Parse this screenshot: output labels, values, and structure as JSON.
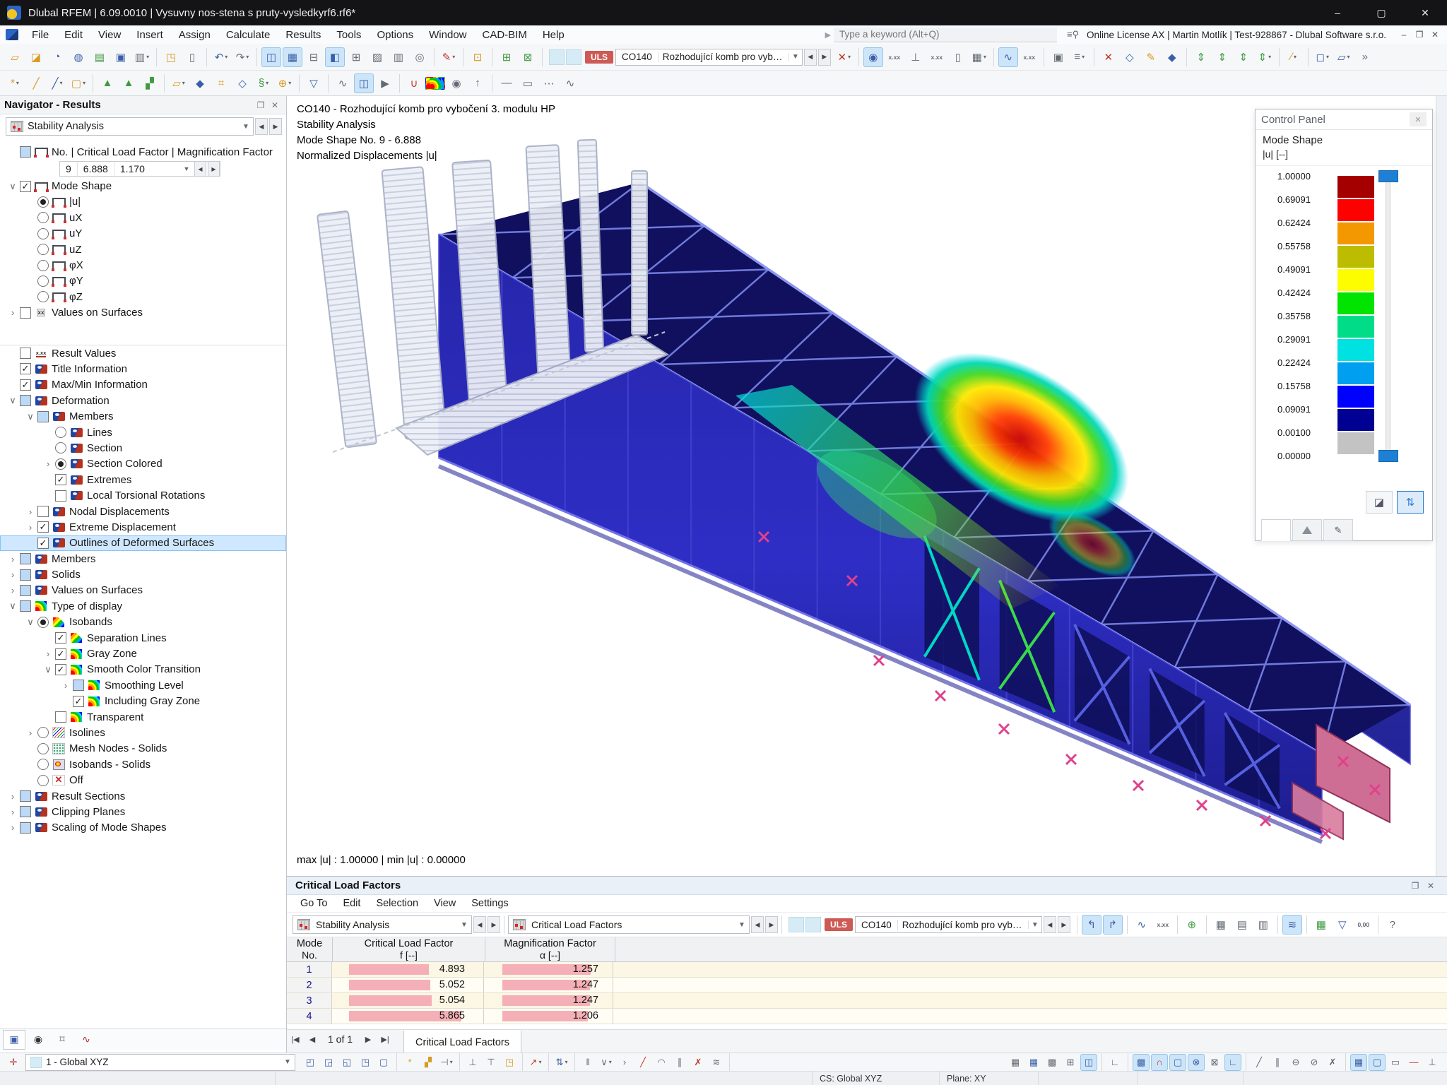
{
  "window": {
    "title": "Dlubal RFEM | 6.09.0010 | Vysuvny nos-stena s pruty-vysledkyrf6.rf6*",
    "minimize": "–",
    "maximize": "▢",
    "close": "✕"
  },
  "menu": {
    "items": [
      "File",
      "Edit",
      "View",
      "Insert",
      "Assign",
      "Calculate",
      "Results",
      "Tools",
      "Options",
      "Window",
      "CAD-BIM",
      "Help"
    ]
  },
  "topbar": {
    "search_placeholder": "Type a keyword (Alt+Q)",
    "license": "Online License AX | Martin Motlík | Test-928867 - Dlubal Software s.r.o."
  },
  "load_combo": {
    "uls": "ULS",
    "co": "CO140",
    "name": "Rozhodující komb pro vyboč..."
  },
  "toolbar1": [
    [
      "▱",
      "y",
      0,
      0,
      "new-model",
      0
    ],
    [
      "◪",
      "y",
      0,
      0,
      "open-model",
      0
    ],
    [
      "◔",
      "b",
      0,
      0,
      "refresh-data",
      0
    ],
    [
      "◍",
      "b",
      0,
      0,
      "rendering",
      0
    ],
    [
      "▤",
      "g",
      0,
      0,
      "printout-graphic",
      0
    ],
    [
      "▣",
      "b",
      0,
      0,
      "save",
      0
    ],
    [
      "▥",
      "k",
      0,
      1,
      "print",
      1
    ],
    [
      "◳",
      "y",
      0,
      0,
      "new-report",
      0
    ],
    [
      "▯",
      "k",
      0,
      1,
      "printout-report",
      0
    ],
    [
      "↶",
      "b",
      0,
      0,
      "undo",
      1
    ],
    [
      "↷",
      "k",
      0,
      1,
      "redo",
      1
    ],
    [
      "◫",
      "b",
      1,
      0,
      "navigator-toggle",
      0
    ],
    [
      "▦",
      "b",
      1,
      0,
      "tables-toggle",
      0
    ],
    [
      "⊟",
      "k",
      0,
      0,
      "split-view",
      0
    ],
    [
      "◧",
      "b",
      1,
      0,
      "panel-toggle",
      0
    ],
    [
      "⊞",
      "k",
      0,
      0,
      "new-window",
      0
    ],
    [
      "▨",
      "k",
      0,
      0,
      "sc-table",
      0
    ],
    [
      "▥",
      "k",
      0,
      0,
      "result-table",
      0
    ],
    [
      "◎",
      "k",
      0,
      1,
      "spotlight",
      0
    ],
    [
      "✎",
      "r",
      0,
      1,
      "edit-mode",
      1
    ],
    [
      "⊡",
      "y",
      0,
      1,
      "edit-table",
      0
    ],
    [
      "⊞",
      "g",
      0,
      0,
      "select-special",
      0
    ],
    [
      "⊠",
      "g",
      0,
      1,
      "deselect",
      0
    ]
  ],
  "toolbar1b": [
    [
      "✕",
      "r",
      0,
      1,
      "delete-results",
      1
    ],
    [
      "◉",
      "b",
      1,
      0,
      "show-results",
      0
    ],
    [
      "x.xx",
      "k",
      0,
      0,
      "result-values",
      0
    ],
    [
      "⊥",
      "k",
      0,
      0,
      "support-results",
      0
    ],
    [
      "x.xx",
      "k",
      0,
      0,
      "max-values",
      0
    ],
    [
      "▯",
      "k",
      0,
      0,
      "result-doc",
      0
    ],
    [
      "▦",
      "k",
      0,
      1,
      "result-tables",
      1
    ],
    [
      "∿",
      "b",
      1,
      0,
      "result-diagrams",
      0
    ],
    [
      "x.xx",
      "k",
      0,
      1,
      "diagram-values",
      0
    ],
    [
      "▣",
      "k",
      0,
      0,
      "save-results",
      0
    ],
    [
      "≡",
      "k",
      0,
      1,
      "calculation-params",
      1
    ],
    [
      "✕",
      "r",
      0,
      0,
      "clear-view",
      0
    ],
    [
      "◇",
      "b",
      0,
      0,
      "isometric-view",
      0
    ],
    [
      "✎",
      "y",
      0,
      0,
      "edit-view",
      0
    ],
    [
      "◆",
      "b",
      0,
      1,
      "view-3d",
      0
    ],
    [
      "⇕",
      "g",
      0,
      0,
      "view-x",
      0
    ],
    [
      "⇕",
      "g",
      0,
      0,
      "view-minus-y",
      0
    ],
    [
      "⇕",
      "g",
      0,
      0,
      "view-z",
      0
    ],
    [
      "⇕",
      "g",
      0,
      1,
      "view-minus-x",
      1
    ],
    [
      "∕",
      "y",
      0,
      1,
      "work-plane",
      1
    ],
    [
      "◻",
      "b",
      0,
      0,
      "visibility",
      1
    ],
    [
      "▱",
      "b",
      0,
      0,
      "user-view",
      1
    ],
    [
      "»",
      "k",
      0,
      0,
      "more-tools",
      0
    ]
  ],
  "toolbar2": [
    [
      "*",
      "y",
      0,
      0,
      "new-node",
      1
    ],
    [
      "╱",
      "y",
      0,
      0,
      "new-line",
      0
    ],
    [
      "╱",
      "b",
      0,
      0,
      "new-line-type",
      1
    ],
    [
      "▢",
      "y",
      0,
      1,
      "new-polyline",
      1
    ],
    [
      "▲",
      "g",
      0,
      0,
      "nodal-support",
      0
    ],
    [
      "▲",
      "g",
      0,
      0,
      "line-support",
      0
    ],
    [
      "▞",
      "g",
      0,
      1,
      "surface-support",
      0
    ],
    [
      "▱",
      "y",
      0,
      0,
      "new-surface",
      1
    ],
    [
      "◆",
      "b",
      0,
      0,
      "new-solid",
      0
    ],
    [
      "⌗",
      "y",
      0,
      0,
      "new-opening",
      0
    ],
    [
      "◇",
      "b",
      0,
      0,
      "new-block",
      0
    ],
    [
      "§",
      "g",
      0,
      0,
      "new-section",
      1
    ],
    [
      "⊕",
      "y",
      0,
      1,
      "insert-object",
      1
    ],
    [
      "▽",
      "b",
      0,
      1,
      "filter-objects",
      0
    ],
    [
      "∿",
      "k",
      0,
      0,
      "diagram-window",
      0
    ],
    [
      "◫",
      "b",
      1,
      0,
      "mode-shape-window",
      0
    ],
    [
      "▶",
      "k",
      0,
      1,
      "animation",
      0
    ],
    [
      "∪",
      "r",
      0,
      0,
      "funnel-tool",
      0
    ],
    [
      "",
      "rain",
      0,
      0,
      "color-scale-tool",
      0
    ],
    [
      "◉",
      "k",
      0,
      0,
      "render-solid",
      0
    ],
    [
      "↑",
      "k",
      0,
      1,
      "walk-mode",
      0
    ],
    [
      "—",
      "k",
      0,
      0,
      "line-style-1",
      0
    ],
    [
      "▭",
      "k",
      0,
      0,
      "line-style-2",
      0
    ],
    [
      "⋯",
      "k",
      0,
      0,
      "line-style-3",
      0
    ],
    [
      "∿",
      "k",
      0,
      0,
      "line-style-4",
      0
    ]
  ],
  "bottom_toolbar": [
    [
      "◰",
      "b",
      0,
      0,
      "select-window",
      0
    ],
    [
      "◲",
      "b",
      0,
      0,
      "select-crossing",
      0
    ],
    [
      "◱",
      "b",
      0,
      0,
      "select-previous",
      0
    ],
    [
      "◳",
      "b",
      0,
      0,
      "select-all",
      0
    ],
    [
      "▢",
      "b",
      0,
      1,
      "select-special",
      0
    ],
    [
      "*",
      "y",
      0,
      0,
      "snap-node",
      0
    ],
    [
      "▞",
      "y",
      0,
      0,
      "snap-grid",
      0
    ],
    [
      "⊣",
      "k",
      0,
      1,
      "dimension-x",
      1
    ],
    [
      "⊥",
      "k",
      0,
      0,
      "dimension-xx",
      0
    ],
    [
      "⊤",
      "k",
      0,
      0,
      "guide-line",
      0
    ],
    [
      "◳",
      "y",
      0,
      1,
      "frame-tool",
      0
    ],
    [
      "↗",
      "r",
      0,
      1,
      "measure",
      1
    ],
    [
      "⇅",
      "b",
      0,
      1,
      "numbering",
      1
    ],
    [
      "‖",
      "k",
      0,
      0,
      "parallel-lines",
      0
    ],
    [
      "∨",
      "k",
      0,
      0,
      "angle-tool",
      1
    ],
    [
      "›",
      "k",
      0,
      0,
      "direction",
      0
    ],
    [
      "╱",
      "r",
      0,
      0,
      "line-tool",
      0
    ],
    [
      "◠",
      "k",
      0,
      0,
      "arc-tool",
      0
    ],
    [
      "∥",
      "k",
      0,
      0,
      "offset-tool",
      0
    ],
    [
      "✗",
      "r",
      0,
      0,
      "cross-tool",
      0
    ],
    [
      "≋",
      "k",
      0,
      1,
      "spline-tool",
      0
    ]
  ],
  "bottom_toolbar_right": [
    [
      "▦",
      "k",
      0,
      0,
      "grid-dots",
      0
    ],
    [
      "▦",
      "b",
      0,
      0,
      "grid-lines",
      0
    ],
    [
      "▩",
      "k",
      0,
      0,
      "grid-points",
      0
    ],
    [
      "⊞",
      "k",
      0,
      0,
      "grid-cartesian",
      0
    ],
    [
      "◫",
      "b",
      1,
      1,
      "snap-settings",
      0
    ],
    [
      "∟",
      "k",
      0,
      1,
      "polar-tracking",
      0
    ],
    [
      "▩",
      "b",
      1,
      0,
      "object-snap",
      0
    ],
    [
      "∩",
      "r",
      1,
      0,
      "magnet-snap",
      0
    ],
    [
      "▢",
      "b",
      1,
      0,
      "midpoint-snap",
      0
    ],
    [
      "⊗",
      "b",
      1,
      0,
      "center-snap",
      0
    ],
    [
      "⊠",
      "k",
      0,
      0,
      "intersection-snap",
      0
    ],
    [
      "∟",
      "b",
      1,
      1,
      "ortho-mode",
      0
    ],
    [
      "╱",
      "k",
      0,
      0,
      "tangent-snap",
      0
    ],
    [
      "∥",
      "k",
      0,
      0,
      "parallel-snap",
      0
    ],
    [
      "⊖",
      "k",
      0,
      0,
      "quadrant-snap",
      0
    ],
    [
      "⊘",
      "k",
      0,
      0,
      "nearest-snap",
      0
    ],
    [
      "✗",
      "k",
      0,
      1,
      "snap-off",
      0
    ],
    [
      "▦",
      "b",
      1,
      0,
      "show-grid",
      0
    ],
    [
      "▢",
      "b",
      1,
      0,
      "show-guides",
      0
    ],
    [
      "▭",
      "k",
      0,
      0,
      "eraser",
      0
    ],
    [
      "—",
      "r",
      0,
      0,
      "redline",
      0
    ],
    [
      "⊥",
      "k",
      0,
      0,
      "comment-tool",
      0
    ]
  ],
  "navigator": {
    "title": "Navigator - Results",
    "analysis_combo": "Stability Analysis",
    "factor": {
      "no": "9",
      "clf": "6.888",
      "mag": "1.170"
    },
    "tree1": [
      {
        "l": 0,
        "c": "check",
        "s": "part",
        "i": "mode",
        "t": "No. | Critical Load Factor | Magnification Factor"
      },
      {
        "type": "factor"
      },
      {
        "l": 0,
        "e": "open",
        "c": "check",
        "s": "on",
        "i": "mode",
        "t": "Mode Shape"
      },
      {
        "l": 1,
        "c": "radio",
        "s": "on",
        "i": "mode",
        "t": "|u|"
      },
      {
        "l": 1,
        "c": "radio",
        "s": "off",
        "i": "mode",
        "t": "uX"
      },
      {
        "l": 1,
        "c": "radio",
        "s": "off",
        "i": "mode",
        "t": "uY"
      },
      {
        "l": 1,
        "c": "radio",
        "s": "off",
        "i": "mode",
        "t": "uZ"
      },
      {
        "l": 1,
        "c": "radio",
        "s": "off",
        "i": "mode",
        "t": "φX"
      },
      {
        "l": 1,
        "c": "radio",
        "s": "off",
        "i": "mode",
        "t": "φY"
      },
      {
        "l": 1,
        "c": "radio",
        "s": "off",
        "i": "mode",
        "t": "φZ"
      },
      {
        "l": 0,
        "e": "closed",
        "c": "check",
        "s": "off",
        "i": "vals",
        "t": "Values on Surfaces"
      }
    ],
    "tree2": [
      {
        "l": 0,
        "c": "check",
        "s": "off",
        "i": "xx",
        "t": "Result Values"
      },
      {
        "l": 0,
        "c": "check",
        "s": "on",
        "i": "eye",
        "t": "Title Information"
      },
      {
        "l": 0,
        "c": "check",
        "s": "on",
        "i": "eye",
        "t": "Max/Min Information"
      },
      {
        "l": 0,
        "e": "open",
        "c": "check",
        "s": "part",
        "i": "eye",
        "t": "Deformation"
      },
      {
        "l": 1,
        "e": "open",
        "c": "check",
        "s": "part",
        "i": "eye",
        "t": "Members"
      },
      {
        "l": 2,
        "c": "radio",
        "s": "off",
        "i": "eye",
        "t": "Lines"
      },
      {
        "l": 2,
        "c": "radio",
        "s": "off",
        "i": "eye",
        "t": "Section"
      },
      {
        "l": 2,
        "e": "closed",
        "c": "radio",
        "s": "on",
        "i": "eye",
        "t": "Section Colored"
      },
      {
        "l": 2,
        "c": "check",
        "s": "on",
        "i": "eye",
        "t": "Extremes"
      },
      {
        "l": 2,
        "c": "check",
        "s": "off",
        "i": "eye",
        "t": "Local Torsional Rotations"
      },
      {
        "l": 1,
        "e": "closed",
        "c": "check",
        "s": "off",
        "i": "eye",
        "t": "Nodal Displacements"
      },
      {
        "l": 1,
        "e": "closed",
        "c": "check",
        "s": "on",
        "i": "eye",
        "t": "Extreme Displacement"
      },
      {
        "l": 1,
        "c": "check",
        "s": "on",
        "i": "eye",
        "t": "Outlines of Deformed Surfaces",
        "sel": true
      },
      {
        "l": 0,
        "e": "closed",
        "c": "check",
        "s": "part",
        "i": "eye",
        "t": "Members"
      },
      {
        "l": 0,
        "e": "closed",
        "c": "check",
        "s": "part",
        "i": "eye",
        "t": "Solids"
      },
      {
        "l": 0,
        "e": "closed",
        "c": "check",
        "s": "part",
        "i": "eye",
        "t": "Values on Surfaces"
      },
      {
        "l": 0,
        "e": "open",
        "c": "check",
        "s": "part",
        "i": "rain",
        "t": "Type of display"
      },
      {
        "l": 1,
        "e": "open",
        "c": "radio",
        "s": "on",
        "i": "iso",
        "t": "Isobands"
      },
      {
        "l": 2,
        "c": "check",
        "s": "on",
        "i": "iso",
        "t": "Separation Lines"
      },
      {
        "l": 2,
        "e": "closed",
        "c": "check",
        "s": "on",
        "i": "rain",
        "t": "Gray Zone"
      },
      {
        "l": 2,
        "e": "open",
        "c": "check",
        "s": "on",
        "i": "rain",
        "t": "Smooth Color Transition"
      },
      {
        "l": 3,
        "e": "closed",
        "c": "check",
        "s": "part",
        "i": "rain",
        "t": "Smoothing Level"
      },
      {
        "l": 3,
        "c": "check",
        "s": "on",
        "i": "rain",
        "t": "Including Gray Zone"
      },
      {
        "l": 2,
        "c": "check",
        "s": "off",
        "i": "rain",
        "t": "Transparent"
      },
      {
        "l": 1,
        "e": "closed",
        "c": "radio",
        "s": "off",
        "i": "isoline",
        "t": "Isolines"
      },
      {
        "l": 1,
        "c": "radio",
        "s": "off",
        "i": "mesh",
        "t": "Mesh Nodes - Solids"
      },
      {
        "l": 1,
        "c": "radio",
        "s": "off",
        "i": "cube",
        "t": "Isobands - Solids"
      },
      {
        "l": 1,
        "c": "radio",
        "s": "off",
        "i": "offx",
        "t": "Off"
      },
      {
        "l": 0,
        "e": "closed",
        "c": "check",
        "s": "part",
        "i": "eye",
        "t": "Result Sections"
      },
      {
        "l": 0,
        "e": "closed",
        "c": "check",
        "s": "part",
        "i": "eye",
        "t": "Clipping Planes"
      },
      {
        "l": 0,
        "e": "closed",
        "c": "check",
        "s": "part",
        "i": "eye",
        "t": "Scaling of Mode Shapes"
      }
    ]
  },
  "viewport": {
    "title_lines": [
      "CO140 - Rozhodující komb pro vybočení 3. modulu HP",
      "Stability Analysis",
      "Mode Shape No. 9 - 6.888",
      "Normalized Displacements |u|"
    ],
    "minmax": "max |u| : 1.00000 | min |u| : 0.00000"
  },
  "control_panel": {
    "title": "Control Panel",
    "section": "Mode Shape",
    "unit": "|u| [--]",
    "scale_labels": [
      "1.00000",
      "0.69091",
      "0.62424",
      "0.55758",
      "0.49091",
      "0.42424",
      "0.35758",
      "0.29091",
      "0.22424",
      "0.15758",
      "0.09091",
      "0.00100",
      "0.00000"
    ],
    "scale_colors": [
      "#a40000",
      "#fe0000",
      "#f39800",
      "#bcbc00",
      "#fdfd00",
      "#00e400",
      "#00dc87",
      "#00e2e2",
      "#009ff0",
      "#0000fe",
      "#000092",
      "#c3c3c3"
    ]
  },
  "dock": {
    "title": "Critical Load Factors",
    "menu": [
      "Go To",
      "Edit",
      "Selection",
      "View",
      "Settings"
    ],
    "combo1": "Stability Analysis",
    "combo2": "Critical Load Factors",
    "toolbar": [
      [
        "↰",
        "b",
        1,
        0,
        "jump-to-graphic",
        0
      ],
      [
        "↱",
        "b",
        1,
        1,
        "jump-from-graphic",
        0
      ],
      [
        "∿",
        "b",
        0,
        0,
        "result-diagram",
        0
      ],
      [
        "x.xx",
        "k",
        0,
        1,
        "show-values",
        0
      ],
      [
        "⊕",
        "g",
        0,
        1,
        "relation-tree",
        0
      ],
      [
        "▦",
        "k",
        0,
        0,
        "table-view",
        0
      ],
      [
        "▤",
        "k",
        0,
        0,
        "export-csv",
        0
      ],
      [
        "▥",
        "k",
        0,
        1,
        "export-xml",
        0
      ],
      [
        "≋",
        "b",
        1,
        1,
        "column-chart",
        0
      ],
      [
        "▦",
        "g",
        0,
        0,
        "excel-export",
        0
      ],
      [
        "▽",
        "b",
        0,
        0,
        "filter-rows",
        0
      ],
      [
        "0,00",
        "k",
        0,
        1,
        "decimal-places",
        0
      ],
      [
        "?",
        "k",
        0,
        0,
        "help",
        0
      ]
    ],
    "columns": {
      "c1a": "Mode",
      "c1b": "No.",
      "c2a": "Critical Load Factor",
      "c2b": "f [--]",
      "c3a": "Magnification Factor",
      "c3b": "α [--]"
    },
    "rows": [
      {
        "no": "1",
        "f": "4.893",
        "fb": 61,
        "a": "1.257",
        "ab": 83
      },
      {
        "no": "2",
        "f": "5.052",
        "fb": 62,
        "a": "1.247",
        "ab": 82
      },
      {
        "no": "3",
        "f": "5.054",
        "fb": 63,
        "a": "1.247",
        "ab": 82
      },
      {
        "no": "4",
        "f": "5.865",
        "fb": 86,
        "a": "1.206",
        "ab": 80
      }
    ],
    "pagination": {
      "first": "|◀",
      "prev": "◀",
      "label": "1 of 1",
      "next": "▶",
      "last": "▶|"
    },
    "tab": "Critical Load Factors"
  },
  "bottombar": {
    "combo": "1 - Global XYZ"
  },
  "statusbar": {
    "cs": "CS: Global XYZ",
    "plane": "Plane: XY"
  }
}
